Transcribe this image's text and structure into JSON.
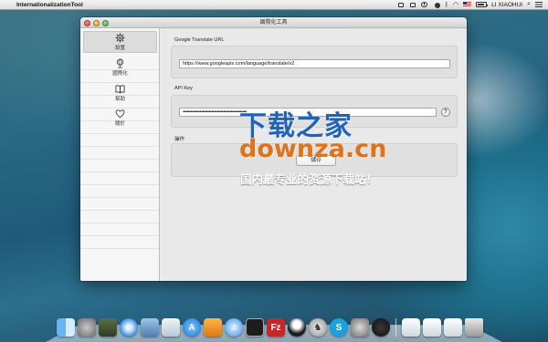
{
  "menubar": {
    "app_name": "InternationalizationTool",
    "user": "LI XIAOHUI",
    "icons": [
      "apple-icon",
      "notification-icon",
      "screenshot-icon",
      "timemachine-icon",
      "status-icon",
      "bluetooth-icon",
      "wifi-icon",
      "input-flag-icon",
      "battery-icon",
      "user-menu",
      "spotlight-icon",
      "notification-center-icon"
    ]
  },
  "window": {
    "title": "國際化工具"
  },
  "sidebar": {
    "items": [
      {
        "label": "設置",
        "icon": "gear-icon"
      },
      {
        "label": "國際化",
        "icon": "globe-icon"
      },
      {
        "label": "幫助",
        "icon": "book-icon"
      },
      {
        "label": "關於",
        "icon": "heart-icon"
      }
    ]
  },
  "content": {
    "translate_url": {
      "label": "Google Translate URL",
      "value": "https://www.googleapis.com/language/translate/v2"
    },
    "api_key": {
      "label": "API Key",
      "value": "•••••••••••••••••••••••••••••••••••••••••••••••••",
      "help": "?"
    },
    "actions": {
      "label": "操作",
      "save": "儲存"
    }
  },
  "watermark": {
    "line1": "下载之家",
    "line2": "downza.cn",
    "line3": "国内最专业的资源下载站！"
  },
  "dock": {
    "apps": [
      "finder-icon",
      "launchpad-icon",
      "mission-control-icon",
      "safari-icon",
      "xcode-icon",
      "preview-icon",
      "app-store-icon",
      "ibooks-icon",
      "itunes-icon",
      "terminal-icon",
      "filezilla-icon",
      "qq-icon",
      "chess-icon",
      "skype-icon",
      "system-preferences-icon",
      "network-icon",
      "stack-1-icon",
      "stack-2-icon",
      "stack-3-icon",
      "trash-icon"
    ],
    "colors": {
      "finder": "#4a90d9",
      "filezilla": "#c62828",
      "skype": "#1aa1e0",
      "terminal": "#1d1d1d"
    }
  }
}
